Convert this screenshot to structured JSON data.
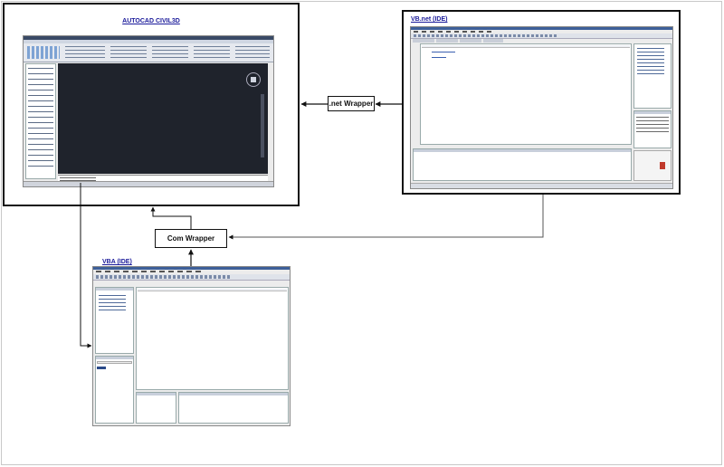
{
  "diagram": {
    "panels": {
      "autocad": {
        "title": "AUTOCAD CIVIL3D"
      },
      "vbnet": {
        "title": "VB.net (IDE)"
      },
      "vba": {
        "title": "VBA (IDE)"
      }
    },
    "wrappers": {
      "net": {
        "label": ".net Wrapper"
      },
      "com": {
        "label": "Com Wrapper"
      }
    },
    "colors": {
      "panel_border": "#111111",
      "title_color": "#1a1a9a",
      "autocad_canvas": "#1f232c",
      "arrow": "#111111",
      "connector": "#555555"
    }
  }
}
